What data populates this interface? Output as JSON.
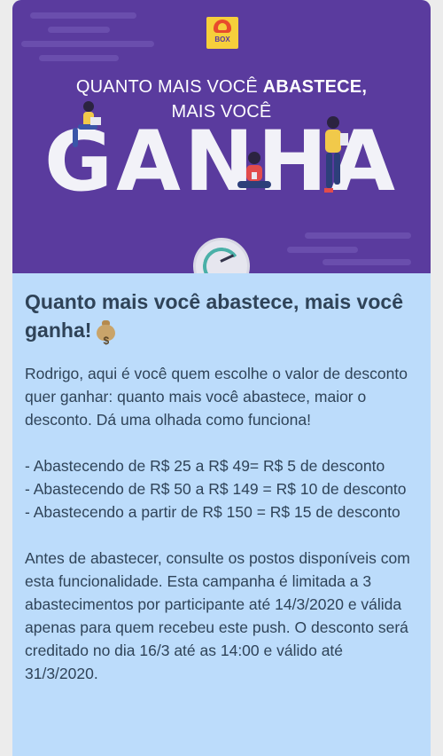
{
  "banner": {
    "logo_text": "BOX",
    "headline_line1_normal": "QUANTO MAIS VOCÊ ",
    "headline_line1_bold": "ABASTECE,",
    "headline_line2": "MAIS VOCÊ",
    "big_word": "GANHA",
    "colors": {
      "background": "#5a3b9e",
      "logo": "#f6cf3b"
    }
  },
  "content": {
    "title": "Quanto mais você abastece, mais você ganha!",
    "title_icon": "money-bag-icon",
    "intro": "Rodrigo, aqui é você quem escolhe o valor de desconto quer ganhar: quanto mais você abastece, maior o desconto. Dá uma olhada como funciona!",
    "tiers": [
      "- Abastecendo de R$ 25 a R$ 49= R$ 5 de desconto",
      "- Abastecendo de R$ 50 a R$ 149 = R$ 10 de desconto",
      "- Abastecendo a partir de R$ 150  = R$ 15 de desconto"
    ],
    "terms": "Antes de abastecer, consulte os postos disponíveis com esta funcionalidade. Esta campanha é limitada a 3 abastecimentos por participante até 14/3/2020 e válida apenas para quem recebeu este push. O desconto será creditado no dia 16/3 até as 14:00 e válido até 31/3/2020.",
    "colors": {
      "background": "#bcdcfb",
      "text": "#2f4358"
    }
  }
}
